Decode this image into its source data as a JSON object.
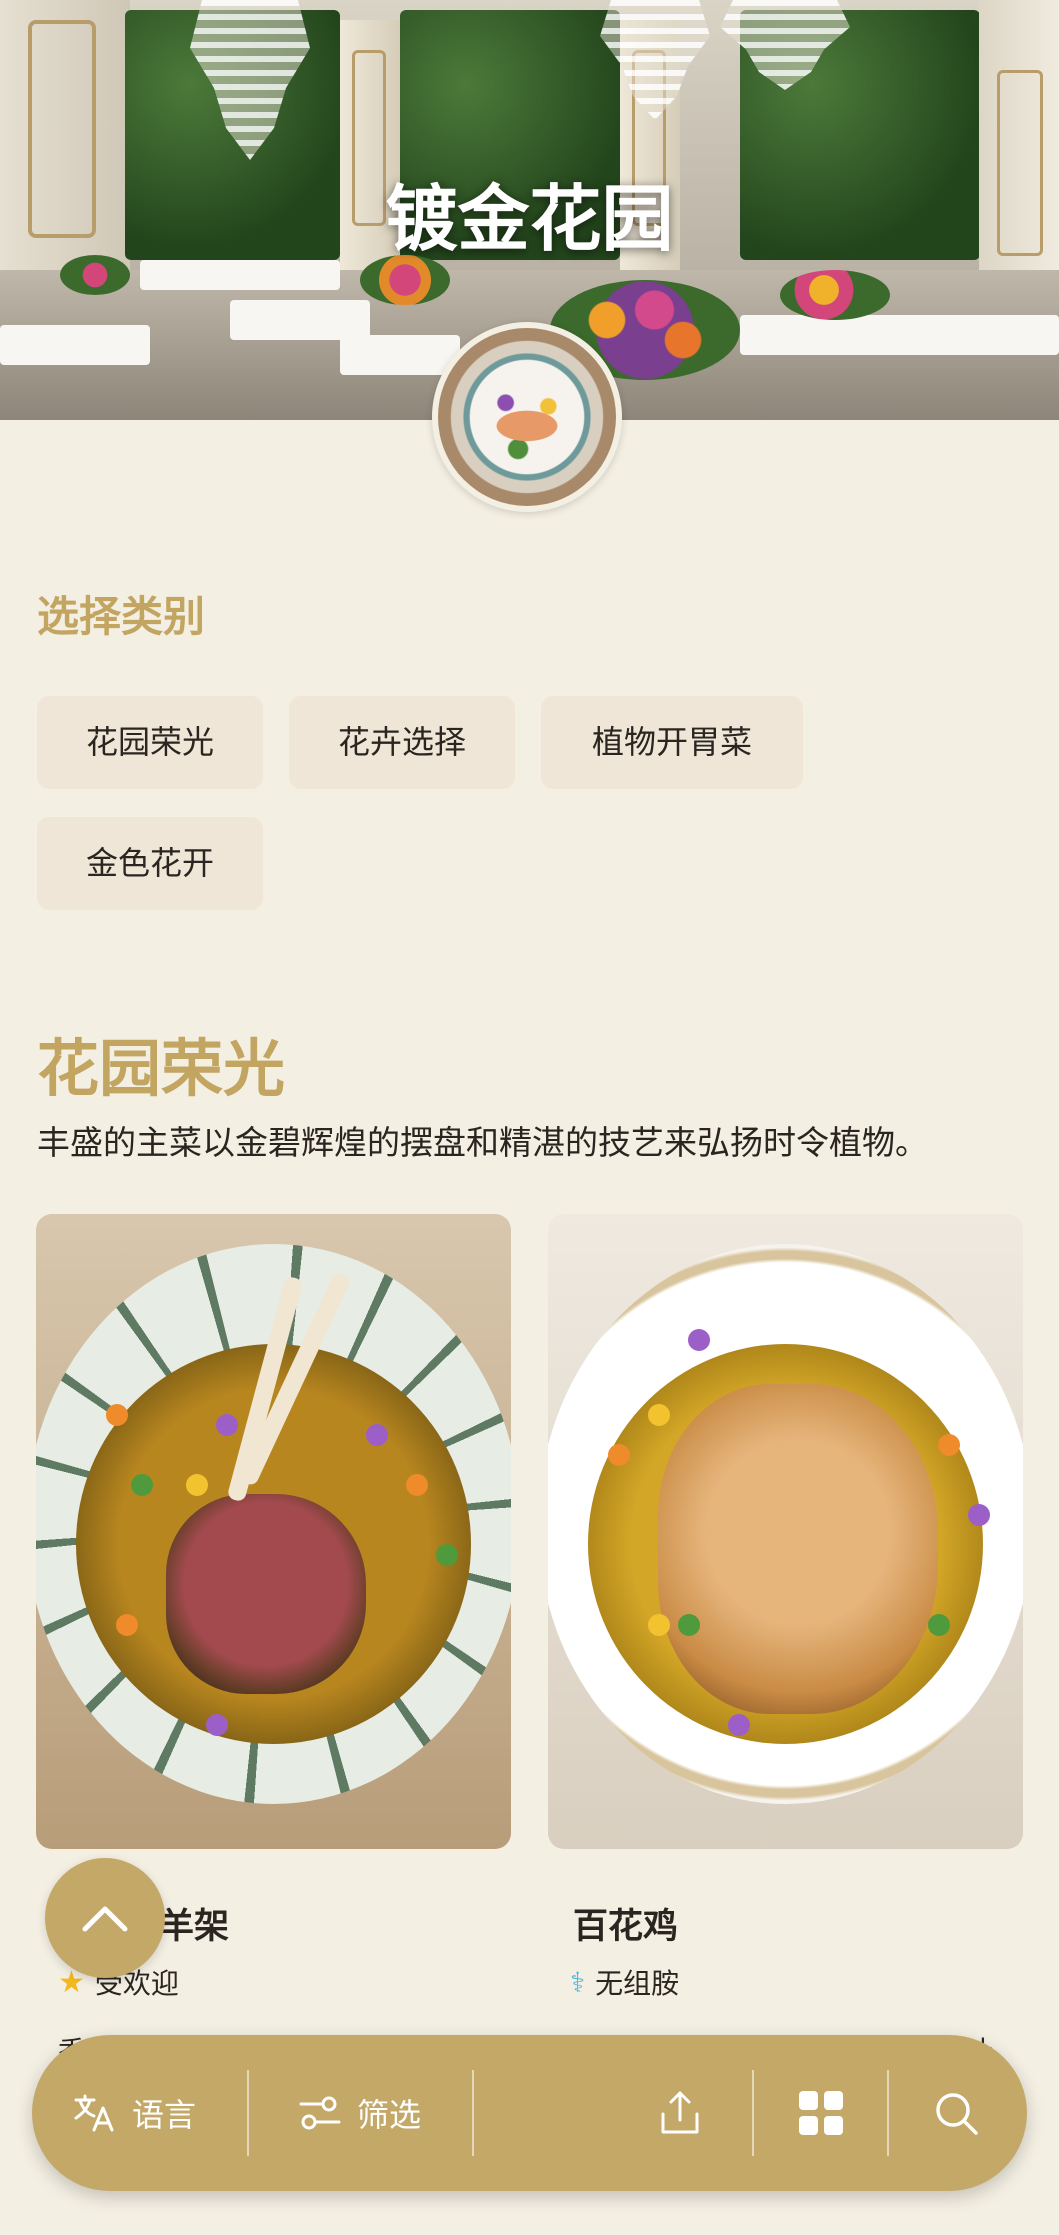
{
  "hero": {
    "title": "镀金花园"
  },
  "categories": {
    "label": "选择类别",
    "items": [
      {
        "label": "花园荣光"
      },
      {
        "label": "花卉选择"
      },
      {
        "label": "植物开胃菜"
      },
      {
        "label": "金色花开"
      }
    ]
  },
  "section": {
    "title": "花园荣光",
    "description": "丰盛的主菜以金碧辉煌的摆盘和精湛的技艺来弘扬时令植物。"
  },
  "dishes": [
    {
      "name": "皮羊架",
      "tag": "受欢迎",
      "tag_icon": "star-icon",
      "snippet": "香"
    },
    {
      "name": "百花鸡",
      "tag": "无组胺",
      "tag_icon": "dna-icon",
      "snippet": "汁"
    }
  ],
  "toolbar": {
    "language": "语言",
    "filter": "筛选"
  },
  "colors": {
    "accent": "#c3a562",
    "toolbar": "#c3a867",
    "background": "#f4efe3",
    "chip": "#efe6d7"
  }
}
